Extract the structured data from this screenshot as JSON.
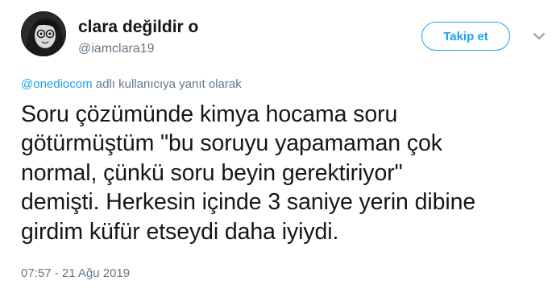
{
  "tweet": {
    "user": {
      "display_name": "clara değildir o",
      "handle": "@iamclara19"
    },
    "follow_button_label": "Takip et",
    "reply_context": {
      "mention": "@onediocom",
      "suffix": " adlı kullanıcıya yanıt olarak"
    },
    "text_lines": [
      "Soru çözümünde kimya hocama soru",
      "götürmüştüm \"bu soruyu yapamaman çok",
      "normal, çünkü soru beyin gerektiriyor\"",
      "demişti. Herkesin içinde 3 saniye yerin dibine",
      "girdim küfür etseydi daha iyiydi."
    ],
    "timestamp": "07:57 - 21 Ağu 2019"
  },
  "colors": {
    "accent": "#1da1f2",
    "text": "#14171a",
    "secondary_text": "#657786"
  },
  "icons": {
    "menu": "chevron-down-icon"
  }
}
